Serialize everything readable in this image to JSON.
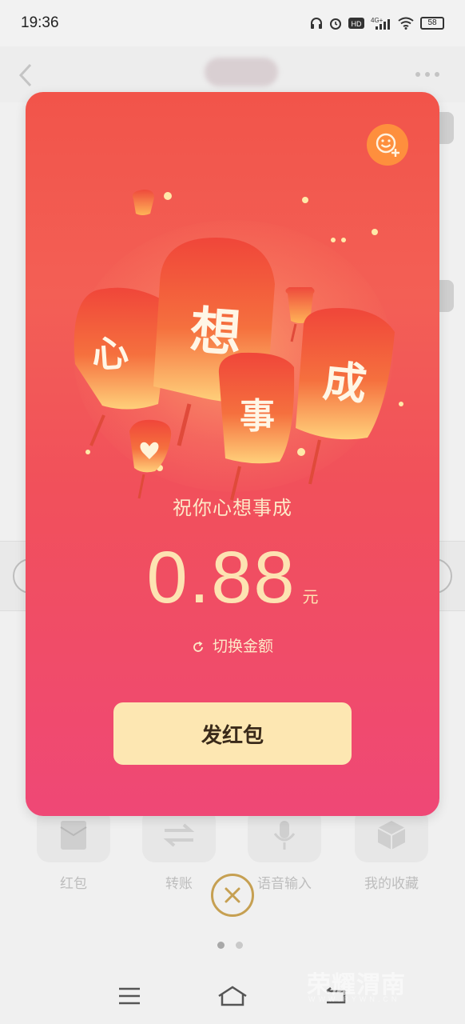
{
  "status_bar": {
    "time": "19:36",
    "network": "4G+",
    "hd": "HD",
    "battery": "58"
  },
  "chat": {
    "icons": [
      "back-icon",
      "more-icon"
    ]
  },
  "actions": [
    {
      "label": "红包",
      "icon": "red-packet-icon"
    },
    {
      "label": "转账",
      "icon": "transfer-icon"
    },
    {
      "label": "语音输入",
      "icon": "microphone-icon"
    },
    {
      "label": "我的收藏",
      "icon": "favorites-cube-icon"
    }
  ],
  "red_packet": {
    "lantern_chars": [
      "心",
      "想",
      "事",
      "成"
    ],
    "blessing": "祝你心想事成",
    "amount": "0.88",
    "unit": "元",
    "switch_label": "切换金额",
    "send_label": "发红包"
  },
  "watermark": {
    "main": "荣耀渭南",
    "sub": "WWW.RYWN.CN"
  },
  "colors": {
    "card_top": "#f2544a",
    "card_bottom": "#ef4876",
    "button_bg": "#fde7b2",
    "gold_text": "#fde3b2",
    "close_ring": "#c6a052"
  }
}
